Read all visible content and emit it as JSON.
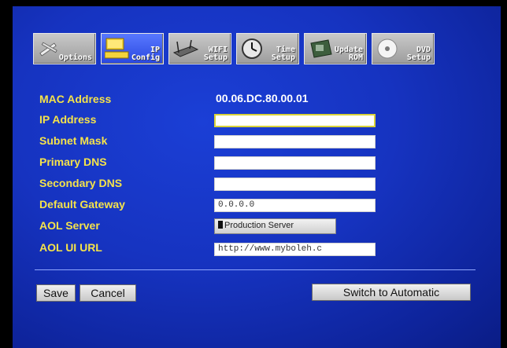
{
  "tabs": [
    {
      "label": "Options",
      "icon": "tools-icon",
      "active": false
    },
    {
      "label": "IP\nConfig",
      "icon": "computer-icon",
      "active": true
    },
    {
      "label": "WIFI\nSetup",
      "icon": "router-icon",
      "active": false
    },
    {
      "label": "Time\nSetup",
      "icon": "clock-icon",
      "active": false
    },
    {
      "label": "Update\nROM",
      "icon": "chip-icon",
      "active": false
    },
    {
      "label": "DVD\nSetup",
      "icon": "disc-icon",
      "active": false
    }
  ],
  "form": {
    "mac_label": "MAC Address",
    "mac_value": "00.06.DC.80.00.01",
    "ip_label": "IP Address",
    "ip_value": "",
    "subnet_label": "Subnet Mask",
    "subnet_value": "",
    "pdns_label": "Primary DNS",
    "pdns_value": "",
    "sdns_label": "Secondary DNS",
    "sdns_value": "",
    "gateway_label": "Default Gateway",
    "gateway_value": "0.0.0.0",
    "aol_server_label": "AOL Server",
    "aol_server_value": "Production Server",
    "aol_url_label": "AOL UI URL",
    "aol_url_value": "http://www.myboleh.c"
  },
  "buttons": {
    "save": "Save",
    "cancel": "Cancel",
    "switch": "Switch to Automatic"
  },
  "colors": {
    "background": "#1633c0",
    "label": "#f5e34a",
    "active_tab": "#3a5cf0"
  }
}
